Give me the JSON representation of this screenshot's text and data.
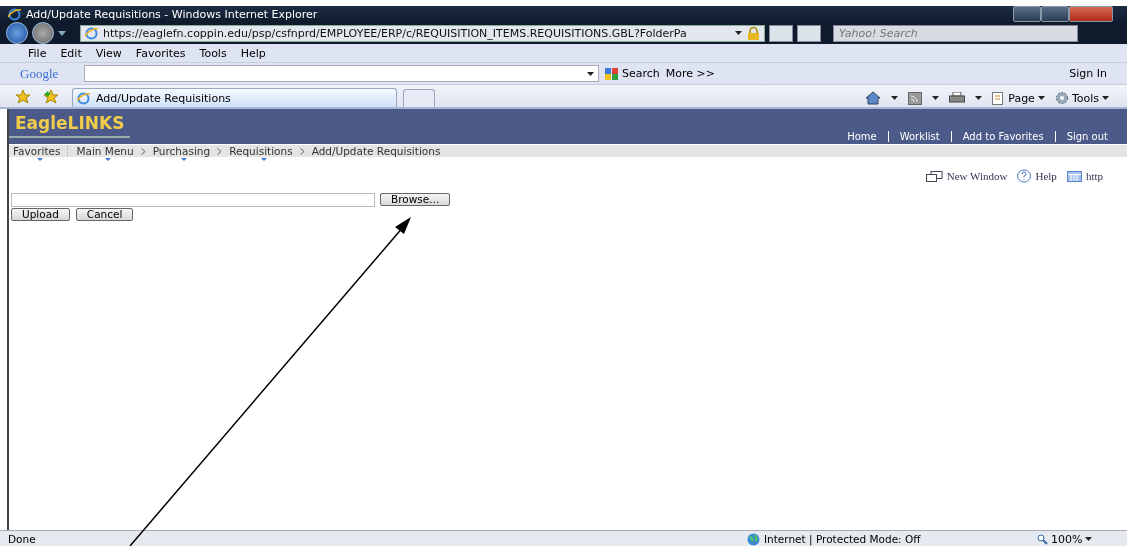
{
  "window": {
    "title": "Add/Update Requisitions - Windows Internet Explorer"
  },
  "address_bar": {
    "url": "https://eaglefn.coppin.edu/psp/csfnprd/EMPLOYEE/ERP/c/REQUISITION_ITEMS.REQUISITIONS.GBL?FolderPa"
  },
  "search_box": {
    "placeholder": "Yahoo! Search"
  },
  "menu_bar": [
    "File",
    "Edit",
    "View",
    "Favorites",
    "Tools",
    "Help"
  ],
  "google_toolbar": {
    "logo": "Google",
    "search_label": "Search",
    "more_label": "More >>",
    "sign_in": "Sign In"
  },
  "tabs": [
    {
      "label": "Add/Update Requisitions",
      "selected": true
    }
  ],
  "command_bar": [
    {
      "kind": "home"
    },
    {
      "kind": "feeds"
    },
    {
      "kind": "print"
    },
    {
      "kind": "page",
      "label": "Page"
    },
    {
      "kind": "tools",
      "label": "Tools"
    }
  ],
  "page": {
    "logo": "EagleLINKS",
    "header_links": [
      "Home",
      "Worklist",
      "Add to Favorites",
      "Sign out"
    ],
    "breadcrumb": [
      {
        "label": "Favorites",
        "menu": true
      },
      {
        "label": "Main Menu",
        "menu": true
      },
      {
        "label": "Purchasing",
        "menu": true
      },
      {
        "label": "Requisitions",
        "menu": true
      },
      {
        "label": "Add/Update Requisitions",
        "menu": false
      }
    ],
    "page_links": [
      {
        "kind": "new-window",
        "label": "New Window"
      },
      {
        "kind": "help",
        "label": "Help"
      },
      {
        "kind": "http",
        "label": "http"
      }
    ],
    "browse_button": "Browse...",
    "buttons": [
      "Upload",
      "Cancel"
    ]
  },
  "status_bar": {
    "status": "Done",
    "zone": "Internet | Protected Mode: Off",
    "zoom": "100%"
  }
}
